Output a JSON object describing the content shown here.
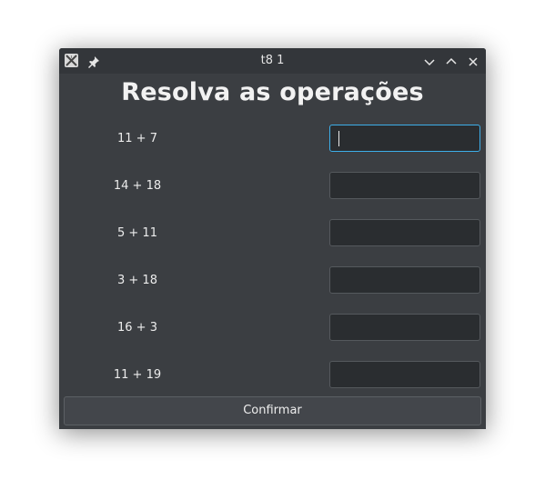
{
  "window": {
    "title": "t8 1"
  },
  "heading": "Resolva as operações",
  "operations": [
    {
      "label": "11 + 7",
      "value": ""
    },
    {
      "label": "14 + 18",
      "value": ""
    },
    {
      "label": "5 + 11",
      "value": ""
    },
    {
      "label": "3 + 18",
      "value": ""
    },
    {
      "label": "16 + 3",
      "value": ""
    },
    {
      "label": "11 + 19",
      "value": ""
    }
  ],
  "confirm_label": "Confirmar",
  "colors": {
    "window_bg": "#3b3e42",
    "titlebar_bg": "#33363a",
    "input_bg": "#2a2d30",
    "focus_border": "#3daee9"
  },
  "icons": {
    "app": "x-app-icon",
    "pin": "pin-icon",
    "minimize": "chevron-down-icon",
    "maximize": "chevron-up-icon",
    "close": "close-icon"
  }
}
